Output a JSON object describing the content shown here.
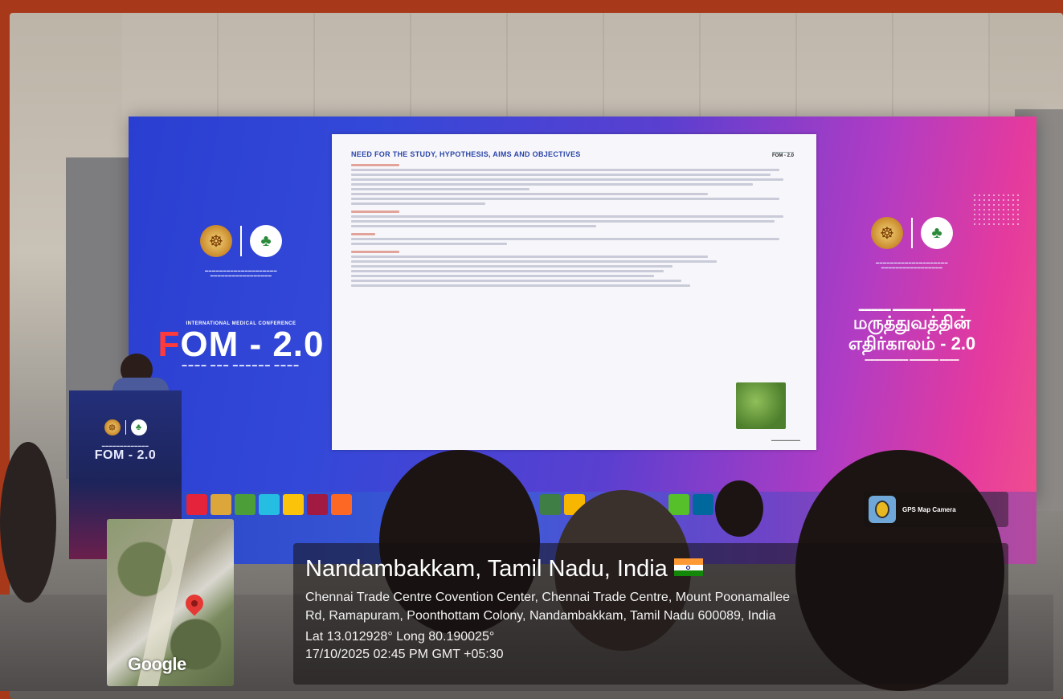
{
  "slide": {
    "title": "NEED FOR THE STUDY, HYPOTHESIS, AIMS AND OBJECTIVES",
    "badge": "FOM - 2.0"
  },
  "left_screen": {
    "conference_label": "INTERNATIONAL MEDICAL CONFERENCE",
    "title_prefix": "F",
    "title_rest": "OM - 2.0"
  },
  "podium": {
    "title": "FOM - 2.0"
  },
  "right_screen": {
    "tamil_big_line1": "மருத்துவத்தின்",
    "tamil_big_line2": "எதிர்காலம் - 2.0"
  },
  "gps": {
    "app_label": "GPS Map Camera",
    "map_brand": "Google",
    "city": "Nandambakkam, Tamil Nadu, India",
    "address_line1": "Chennai Trade Centre Covention Center, Chennai Trade Centre, Mount Poonamallee",
    "address_line2": "Rd, Ramapuram, Poonthottam Colony, Nandambakkam, Tamil Nadu 600089, India",
    "coordinates": "Lat 13.012928° Long 80.190025°",
    "datetime": "17/10/2025 02:45 PM GMT +05:30"
  },
  "colors": {
    "frame": "#a8381a",
    "screen_blue": "#2a3fd1",
    "screen_pink": "#f04d8f",
    "slide_title": "#2b45a8"
  }
}
